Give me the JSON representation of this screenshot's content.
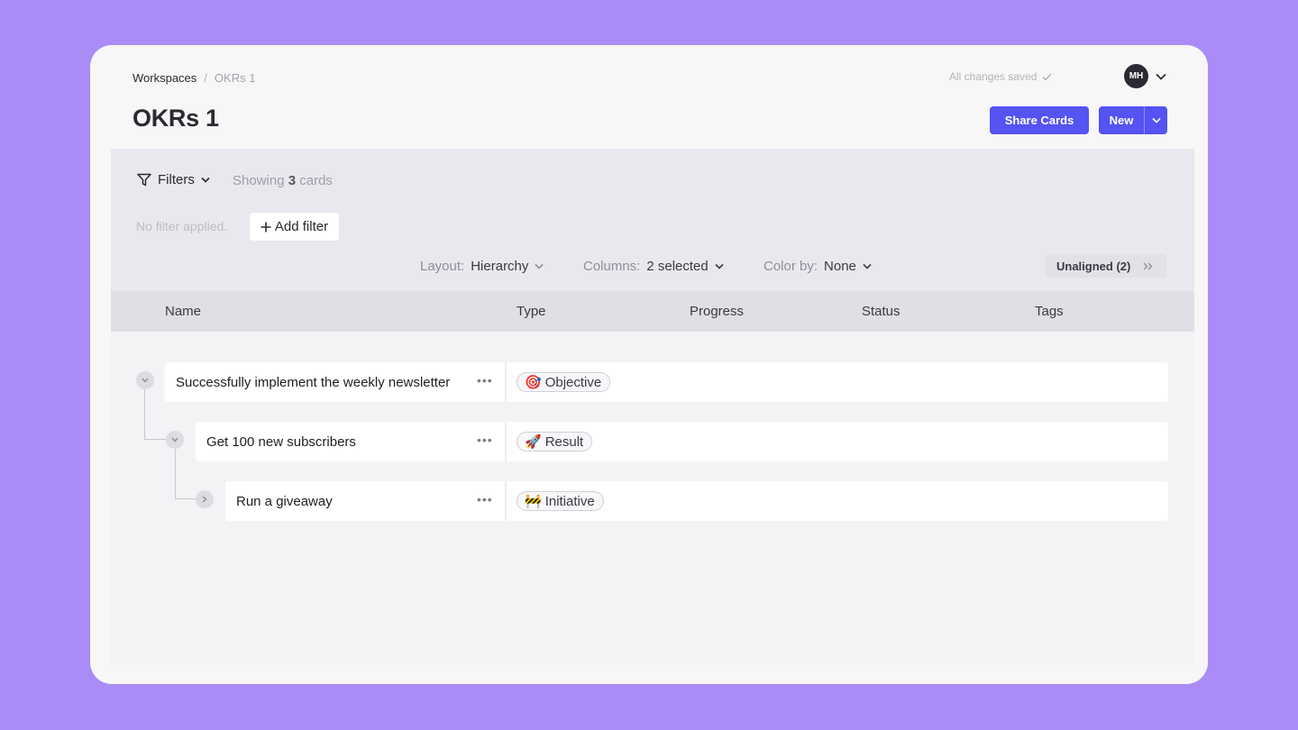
{
  "breadcrumb": {
    "root": "Workspaces",
    "separator": "/",
    "current": "OKRs 1"
  },
  "save_status": "All changes saved",
  "user": {
    "initials": "MH"
  },
  "page_title": "OKRs 1",
  "actions": {
    "share_label": "Share Cards",
    "new_label": "New"
  },
  "filters": {
    "label": "Filters",
    "showing_prefix": "Showing",
    "count": "3",
    "showing_suffix": "cards",
    "no_filter": "No filter applied.",
    "add_filter": "Add filter"
  },
  "view_options": {
    "layout_label": "Layout:",
    "layout_value": "Hierarchy",
    "columns_label": "Columns:",
    "columns_value": "2 selected",
    "color_label": "Color by:",
    "color_value": "None",
    "unaligned": "Unaligned (2)"
  },
  "columns": [
    "Name",
    "Type",
    "Progress",
    "Status",
    "Tags"
  ],
  "rows": [
    {
      "name": "Successfully implement the weekly newsletter",
      "type": "Objective",
      "type_emoji": "🎯",
      "expanded": true
    },
    {
      "name": "Get 100 new subscribers",
      "type": "Result",
      "type_emoji": "🚀",
      "expanded": true
    },
    {
      "name": "Run a giveaway",
      "type": "Initiative",
      "type_emoji": "🚧",
      "expanded": false
    }
  ],
  "colors": {
    "accent": "#5553f2",
    "background": "#ab8cf7"
  }
}
